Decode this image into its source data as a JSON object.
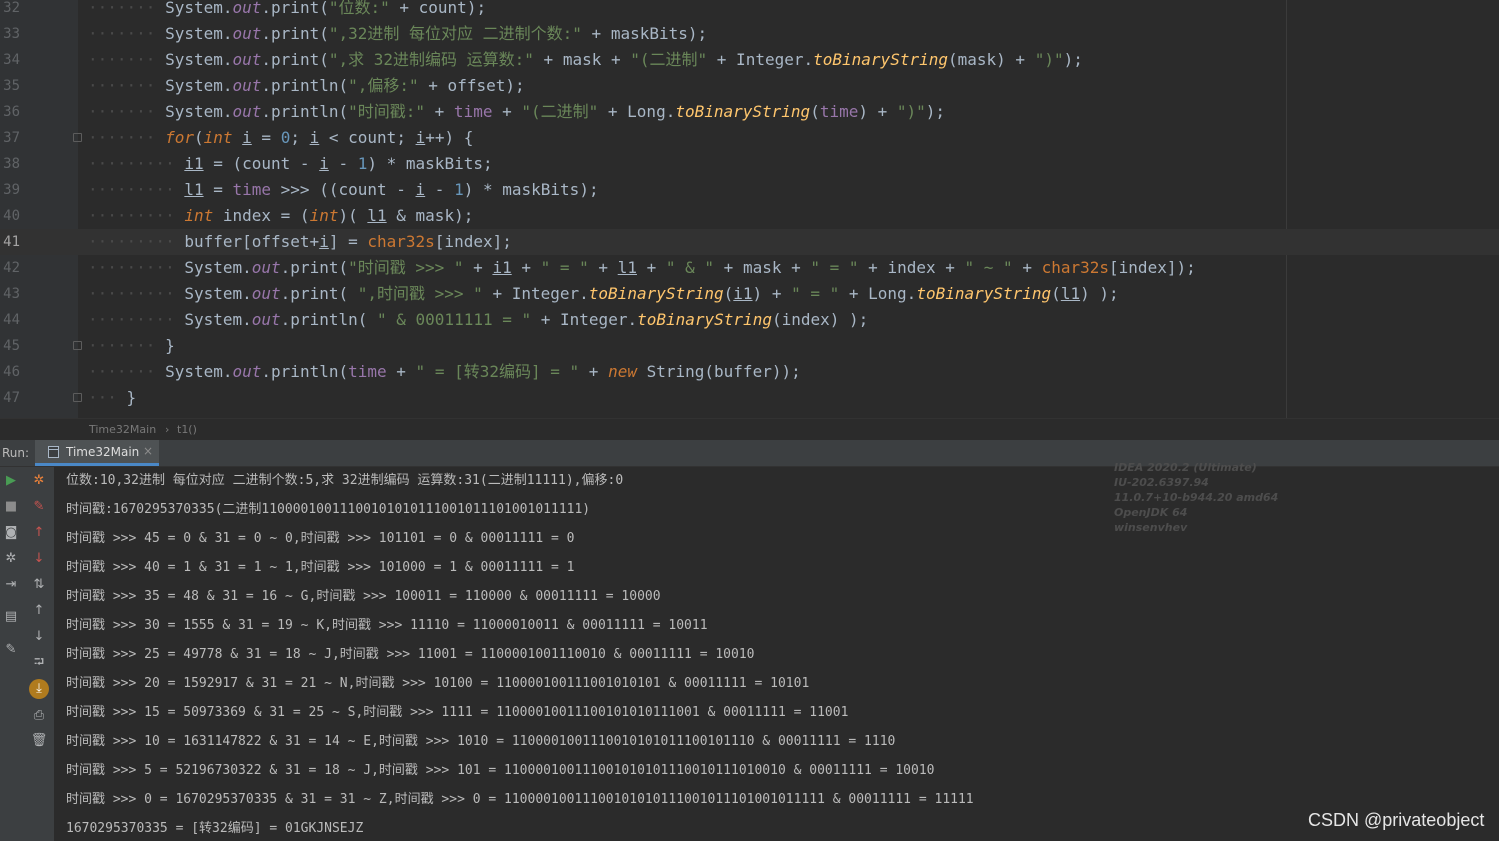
{
  "editor": {
    "lines": [
      {
        "n": "32",
        "indent": 4,
        "current": false,
        "fold": false,
        "tokens": [
          [
            "t",
            "System."
          ],
          [
            "fld",
            "out"
          ],
          [
            "t",
            ".print("
          ],
          [
            "str",
            "\"位数:\""
          ],
          [
            "t",
            " + count);"
          ]
        ]
      },
      {
        "n": "33",
        "indent": 4,
        "current": false,
        "fold": false,
        "tokens": [
          [
            "t",
            "System."
          ],
          [
            "fld",
            "out"
          ],
          [
            "t",
            ".print("
          ],
          [
            "str",
            "\",32进制 每位对应 二进制个数:\""
          ],
          [
            "t",
            " + maskBits);"
          ]
        ]
      },
      {
        "n": "34",
        "indent": 4,
        "current": false,
        "fold": false,
        "tokens": [
          [
            "t",
            "System."
          ],
          [
            "fld",
            "out"
          ],
          [
            "t",
            ".print("
          ],
          [
            "str",
            "\",求 32进制编码 运算数:\""
          ],
          [
            "t",
            " + mask + "
          ],
          [
            "str",
            "\"(二进制\""
          ],
          [
            "t",
            " + Integer."
          ],
          [
            "sm",
            "toBinaryString"
          ],
          [
            "t",
            "(mask) + "
          ],
          [
            "str",
            "\")\""
          ],
          [
            "t",
            ");"
          ]
        ]
      },
      {
        "n": "35",
        "indent": 4,
        "current": false,
        "fold": false,
        "tokens": [
          [
            "t",
            "System."
          ],
          [
            "fld",
            "out"
          ],
          [
            "t",
            ".println("
          ],
          [
            "str",
            "\",偏移:\""
          ],
          [
            "t",
            " + offset);"
          ]
        ]
      },
      {
        "n": "36",
        "indent": 4,
        "current": false,
        "fold": false,
        "tokens": [
          [
            "t",
            "System."
          ],
          [
            "fld",
            "out"
          ],
          [
            "t",
            ".println("
          ],
          [
            "str",
            "\"时间戳:\""
          ],
          [
            "t",
            " + "
          ],
          [
            "ifld",
            "time"
          ],
          [
            "t",
            " + "
          ],
          [
            "str",
            "\"(二进制\""
          ],
          [
            "t",
            " + Long."
          ],
          [
            "sm",
            "toBinaryString"
          ],
          [
            "t",
            "("
          ],
          [
            "ifld",
            "time"
          ],
          [
            "t",
            ") + "
          ],
          [
            "str",
            "\")\""
          ],
          [
            "t",
            ");"
          ]
        ]
      },
      {
        "n": "37",
        "indent": 4,
        "current": false,
        "fold": true,
        "tokens": [
          [
            "kwi",
            "for"
          ],
          [
            "t",
            "("
          ],
          [
            "kwi",
            "int"
          ],
          [
            "t",
            " "
          ],
          [
            "var",
            "i"
          ],
          [
            "t",
            " = "
          ],
          [
            "num",
            "0"
          ],
          [
            "t",
            "; "
          ],
          [
            "var",
            "i"
          ],
          [
            "t",
            " < count; "
          ],
          [
            "var",
            "i"
          ],
          [
            "t",
            "++) {"
          ]
        ]
      },
      {
        "n": "38",
        "indent": 5,
        "current": false,
        "fold": false,
        "tokens": [
          [
            "var",
            "i1"
          ],
          [
            "t",
            " = (count - "
          ],
          [
            "var",
            "i"
          ],
          [
            "t",
            " - "
          ],
          [
            "num",
            "1"
          ],
          [
            "t",
            ") * maskBits;"
          ]
        ]
      },
      {
        "n": "39",
        "indent": 5,
        "current": false,
        "fold": false,
        "tokens": [
          [
            "var",
            "l1"
          ],
          [
            "t",
            " = "
          ],
          [
            "ifld",
            "time"
          ],
          [
            "t",
            " >>> ((count - "
          ],
          [
            "var",
            "i"
          ],
          [
            "t",
            " - "
          ],
          [
            "num",
            "1"
          ],
          [
            "t",
            ") * maskBits);"
          ]
        ]
      },
      {
        "n": "40",
        "indent": 5,
        "current": false,
        "fold": false,
        "tokens": [
          [
            "kwi",
            "int"
          ],
          [
            "t",
            " index = ("
          ],
          [
            "kwi",
            "int"
          ],
          [
            "t",
            ")( "
          ],
          [
            "var",
            "l1"
          ],
          [
            "t",
            " & mask);"
          ]
        ]
      },
      {
        "n": "41",
        "indent": 5,
        "current": true,
        "fold": false,
        "tokens": [
          [
            "t",
            "buffer[offset+"
          ],
          [
            "var",
            "i"
          ],
          [
            "t",
            "] = "
          ],
          [
            "kw",
            "char32s"
          ],
          [
            "t",
            "[index];"
          ]
        ]
      },
      {
        "n": "42",
        "indent": 5,
        "current": false,
        "fold": false,
        "tokens": [
          [
            "t",
            "System."
          ],
          [
            "fld",
            "out"
          ],
          [
            "t",
            ".print("
          ],
          [
            "str",
            "\"时间戳 >>> \""
          ],
          [
            "t",
            " + "
          ],
          [
            "var",
            "i1"
          ],
          [
            "t",
            " + "
          ],
          [
            "str",
            "\" = \""
          ],
          [
            "t",
            " + "
          ],
          [
            "var",
            "l1"
          ],
          [
            "t",
            " + "
          ],
          [
            "str",
            "\" & \""
          ],
          [
            "t",
            " + mask + "
          ],
          [
            "str",
            "\" = \""
          ],
          [
            "t",
            " + index + "
          ],
          [
            "str",
            "\" ~ \""
          ],
          [
            "t",
            " + "
          ],
          [
            "kw",
            "char32s"
          ],
          [
            "t",
            "[index]);"
          ]
        ]
      },
      {
        "n": "43",
        "indent": 5,
        "current": false,
        "fold": false,
        "tokens": [
          [
            "t",
            "System."
          ],
          [
            "fld",
            "out"
          ],
          [
            "t",
            ".print( "
          ],
          [
            "str",
            "\",时间戳 >>> \""
          ],
          [
            "t",
            " + Integer."
          ],
          [
            "sm",
            "toBinaryString"
          ],
          [
            "t",
            "("
          ],
          [
            "var",
            "i1"
          ],
          [
            "t",
            ") + "
          ],
          [
            "str",
            "\" = \""
          ],
          [
            "t",
            " + Long."
          ],
          [
            "sm",
            "toBinaryString"
          ],
          [
            "t",
            "("
          ],
          [
            "var",
            "l1"
          ],
          [
            "t",
            ") );"
          ]
        ]
      },
      {
        "n": "44",
        "indent": 5,
        "current": false,
        "fold": false,
        "tokens": [
          [
            "t",
            "System."
          ],
          [
            "fld",
            "out"
          ],
          [
            "t",
            ".println( "
          ],
          [
            "str",
            "\" & 00011111 = \""
          ],
          [
            "t",
            " + Integer."
          ],
          [
            "sm",
            "toBinaryString"
          ],
          [
            "t",
            "(index) );"
          ]
        ]
      },
      {
        "n": "45",
        "indent": 4,
        "current": false,
        "fold": true,
        "tokens": [
          [
            "t",
            "}"
          ]
        ]
      },
      {
        "n": "46",
        "indent": 4,
        "current": false,
        "fold": false,
        "tokens": [
          [
            "t",
            "System."
          ],
          [
            "fld",
            "out"
          ],
          [
            "t",
            ".println("
          ],
          [
            "ifld",
            "time"
          ],
          [
            "t",
            " + "
          ],
          [
            "str",
            "\" = [转32编码] = \""
          ],
          [
            "t",
            " + "
          ],
          [
            "kwi",
            "new"
          ],
          [
            "t",
            " String(buffer));"
          ]
        ]
      },
      {
        "n": "47",
        "indent": 2,
        "current": false,
        "fold": true,
        "tokens": [
          [
            "t",
            "}"
          ]
        ]
      }
    ]
  },
  "breadcrumb": {
    "class_name": "Time32Main",
    "separator": "›",
    "method": "t1()"
  },
  "run_panel": {
    "label": "Run:",
    "tab_label": "Time32Main",
    "tab_close": "×",
    "toolbar_left": [
      {
        "name": "rerun-icon",
        "glyph": "▶",
        "color": "#499c54"
      },
      {
        "name": "stop-icon",
        "glyph": "■",
        "color": "#8c8c8c"
      },
      {
        "name": "camera-icon",
        "glyph": "◙",
        "color": "#afb1b3"
      },
      {
        "name": "debug-bug-icon",
        "glyph": "✲",
        "color": "#afb1b3"
      },
      {
        "name": "login-icon",
        "glyph": "⇥",
        "color": "#afb1b3"
      },
      {
        "name": "layout-icon",
        "glyph": "▤",
        "color": "#afb1b3"
      },
      {
        "name": "pin-icon",
        "glyph": "✎",
        "color": "#afb1b3"
      }
    ],
    "toolbar_right": [
      {
        "name": "rerun-failed-icon",
        "glyph": "✲",
        "color": "#e8813b"
      },
      {
        "name": "clear-output-icon",
        "glyph": "✎",
        "color": "#c75450"
      },
      {
        "name": "up-arrow-icon",
        "glyph": "↑",
        "color": "#c75450"
      },
      {
        "name": "down-arrow-icon",
        "glyph": "↓",
        "color": "#c75450"
      },
      {
        "name": "sort-icon",
        "glyph": "⇅",
        "color": "#afb1b3"
      },
      {
        "name": "scroll-up-icon",
        "glyph": "↑",
        "color": "#afb1b3"
      },
      {
        "name": "scroll-down-icon",
        "glyph": "↓",
        "color": "#afb1b3"
      },
      {
        "name": "soft-wrap-icon",
        "glyph": "⮒",
        "color": "#afb1b3"
      },
      {
        "name": "scroll-to-end-icon",
        "glyph": "⤓",
        "color": "#ffffff"
      },
      {
        "name": "print-icon",
        "glyph": "⎙",
        "color": "#afb1b3"
      },
      {
        "name": "trash-icon",
        "glyph": "🗑",
        "color": "#afb1b3"
      }
    ],
    "output_lines": [
      "位数:10,32进制 每位对应 二进制个数:5,求 32进制编码 运算数:31(二进制11111),偏移:0",
      "时间戳:1670295370335(二进制11000010011100101010111001011101001011111)",
      "时间戳 >>> 45 = 0 & 31 = 0 ~ 0,时间戳 >>> 101101 = 0 & 00011111 = 0",
      "时间戳 >>> 40 = 1 & 31 = 1 ~ 1,时间戳 >>> 101000 = 1 & 00011111 = 1",
      "时间戳 >>> 35 = 48 & 31 = 16 ~ G,时间戳 >>> 100011 = 110000 & 00011111 = 10000",
      "时间戳 >>> 30 = 1555 & 31 = 19 ~ K,时间戳 >>> 11110 = 11000010011 & 00011111 = 10011",
      "时间戳 >>> 25 = 49778 & 31 = 18 ~ J,时间戳 >>> 11001 = 1100001001110010 & 00011111 = 10010",
      "时间戳 >>> 20 = 1592917 & 31 = 21 ~ N,时间戳 >>> 10100 = 110000100111001010101 & 00011111 = 10101",
      "时间戳 >>> 15 = 50973369 & 31 = 25 ~ S,时间戳 >>> 1111 = 11000010011100101010111001 & 00011111 = 11001",
      "时间戳 >>> 10 = 1631147822 & 31 = 14 ~ E,时间戳 >>> 1010 = 1100001001110010101011100101110 & 00011111 = 1110",
      "时间戳 >>> 5 = 52196730322 & 31 = 18 ~ J,时间戳 >>> 101 = 110000100111001010101110010111010010 & 00011111 = 10010",
      "时间戳 >>> 0 = 1670295370335 & 31 = 31 ~ Z,时间戳 >>> 0 = 11000010011100101010111001011101001011111 & 00011111 = 11111",
      "1670295370335 = [转32编码] = 01GKJNSEJZ"
    ]
  },
  "about_overlay": [
    "IDEA 2020.2 (Ultimate)",
    "IU-202.6397.94",
    "11.0.7+10-b944.20 amd64",
    "OpenJDK 64",
    "winsenvhev"
  ],
  "watermark": "CSDN @privateobject",
  "colors": {
    "editor_bg": "#2b2b2b",
    "gutter_bg": "#313335",
    "current_line": "#323232",
    "keyword": "#cc7832",
    "string": "#6a8759",
    "number": "#6897bb",
    "field": "#9876aa",
    "static_method": "#ffc66d",
    "tab_underline": "#4a88c7"
  }
}
